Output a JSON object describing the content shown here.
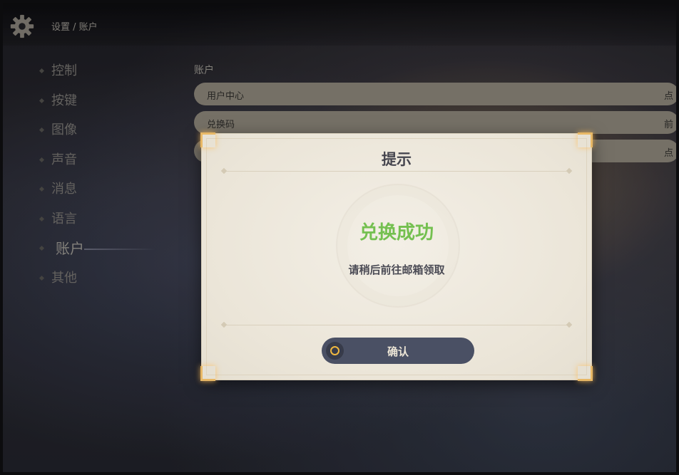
{
  "header": {
    "breadcrumb": "设置 / 账户"
  },
  "sidebar": {
    "items": [
      {
        "label": "控制"
      },
      {
        "label": "按键"
      },
      {
        "label": "图像"
      },
      {
        "label": "声音"
      },
      {
        "label": "消息"
      },
      {
        "label": "语言"
      },
      {
        "label": "账户",
        "active": true
      },
      {
        "label": "其他"
      }
    ]
  },
  "content": {
    "section_title": "账户",
    "rows": [
      {
        "label": "用户中心",
        "action": "点"
      },
      {
        "label": "兑换码",
        "action": "前"
      },
      {
        "label": "",
        "action": "点"
      }
    ]
  },
  "dialog": {
    "title": "提示",
    "success": "兑换成功",
    "message": "请稍后前往邮箱领取",
    "confirm_label": "确认"
  },
  "colors": {
    "success_green": "#74c050",
    "button_bg": "#4a5064",
    "corner_gold": "#e8b866",
    "dialog_bg": "#ede7db"
  },
  "icons": {
    "settings": "gear-icon",
    "confirm_key": "circle-key-icon"
  }
}
